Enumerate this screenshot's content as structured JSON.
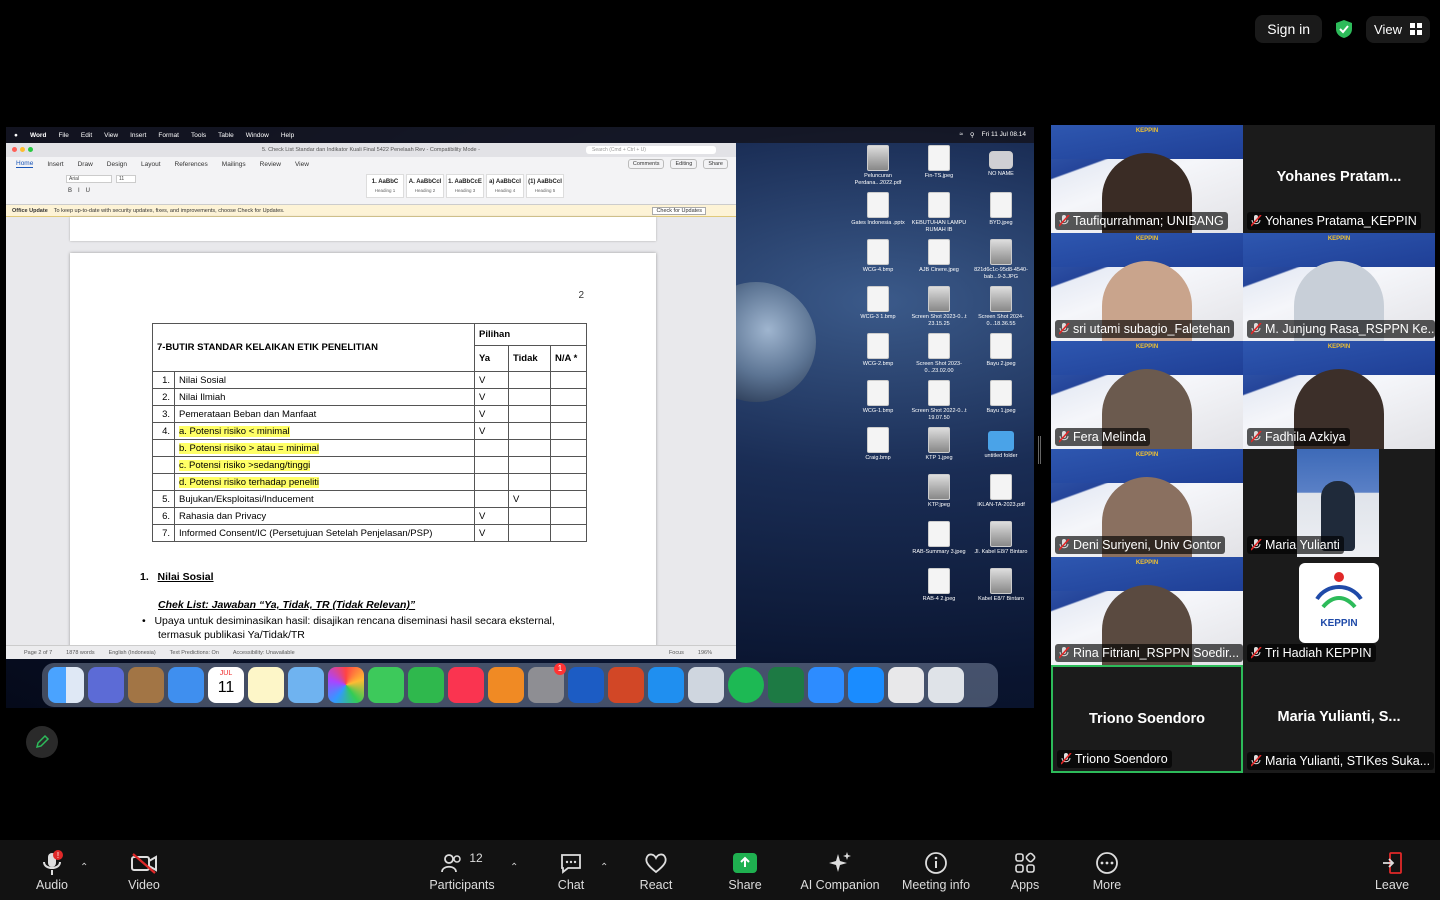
{
  "topbar": {
    "signin": "Sign in",
    "view": "View"
  },
  "macbar": {
    "app": "Word",
    "menus": [
      "File",
      "Edit",
      "View",
      "Insert",
      "Format",
      "Tools",
      "Table",
      "Window",
      "Help"
    ],
    "clock": "Fri 11 Jul  08.14"
  },
  "word": {
    "title": "5. Check List Standar dan Indikator Kuali Final 5422 Penelaah Rev  -  Compatibility Mode  -",
    "search": "Search (Cmd + Ctrl + U)",
    "tabs": [
      "Home",
      "Insert",
      "Draw",
      "Design",
      "Layout",
      "References",
      "Mailings",
      "Review",
      "View"
    ],
    "comments": "Comments",
    "editing": "Editing",
    "share": "Share",
    "font": "Arial",
    "size": "11",
    "styles": [
      {
        "s": "1.  AaBbC",
        "n": "Heading 1"
      },
      {
        "s": "A. AaBbCcI",
        "n": "Heading 2"
      },
      {
        "s": "1. AaBbCcE",
        "n": "Heading 3"
      },
      {
        "s": "a) AaBbCcI",
        "n": "Heading 4"
      },
      {
        "s": "(1) AaBbCcI",
        "n": "Heading 5"
      }
    ],
    "update_title": "Office Update",
    "update_text": "To keep up-to-date with security updates, fixes, and improvements, choose Check for Updates.",
    "update_btn": "Check for Updates",
    "page_no": "2",
    "table_title": "7-BUTIR STANDAR KELAIKAN ETIK PENELITIAN",
    "col_pilihan": "Pilihan",
    "col_ya": "Ya",
    "col_tidak": "Tidak",
    "col_na": "N/A *",
    "rows": [
      {
        "n": "1.",
        "t": "Nilai Sosial",
        "ya": "V",
        "tidak": ""
      },
      {
        "n": "2.",
        "t": "Nilai Ilmiah",
        "ya": "V",
        "tidak": ""
      },
      {
        "n": "3.",
        "t": "Pemerataan Beban dan Manfaat",
        "ya": "V",
        "tidak": ""
      },
      {
        "n": "4.",
        "t": "a.    Potensi risiko < minimal",
        "ya": "V",
        "tidak": ""
      },
      {
        "n": "",
        "t": "b.    Potensi risiko > atau = minimal",
        "ya": "",
        "tidak": ""
      },
      {
        "n": "",
        "t": "c.    Potensi risiko >sedang/tinggi",
        "ya": "",
        "tidak": ""
      },
      {
        "n": "",
        "t": "d.    Potensi risiko terhadap peneliti",
        "ya": "",
        "tidak": ""
      },
      {
        "n": "5.",
        "t": "Bujukan/Eksploitasi/Inducement",
        "ya": "",
        "tidak": "V"
      },
      {
        "n": "6.",
        "t": "Rahasia dan Privacy",
        "ya": "V",
        "tidak": ""
      },
      {
        "n": "7.",
        "t": "Informed Consent/IC (Persetujuan Setelah Penjelasan/PSP)",
        "ya": "V",
        "tidak": ""
      }
    ],
    "section_num": "1.",
    "section_title": "Nilai Sosial",
    "checklist": "Chek List: Jawaban “Ya, Tidak, TR (Tidak Relevan)”",
    "bullet1": "Upaya untuk desiminasikan hasil: disajikan rencana diseminasi hasil secara eksternal,",
    "bullet1b": "termasuk publikasi Ya/Tidak/TR",
    "status": [
      "Page 2 of 7",
      "1878 words",
      "English (Indonesia)",
      "Text Predictions: On",
      "Accessibility: Unavailable",
      "Focus",
      "196%"
    ]
  },
  "desktop_icons": [
    {
      "label": "Peluncuran Perdana...2022.pdf"
    },
    {
      "label": "Fin-TS.jpeg"
    },
    {
      "label": "NO NAME"
    },
    {
      "label": "Gates Indonesia .pptx"
    },
    {
      "label": "KEBUTUHAN LAMPU RUMAH IB"
    },
    {
      "label": "BYD.jpeg"
    },
    {
      "label": "WCG-4.bmp"
    },
    {
      "label": "AJB Cinere.jpeg"
    },
    {
      "label": "821d6c1c-95d8-4540-bab...9-3.JPG"
    },
    {
      "label": "WCG-3 1.bmp"
    },
    {
      "label": "Screen Shot 2023-0...t 23.15.25"
    },
    {
      "label": "Screen Shot 2024-0...18.36.55"
    },
    {
      "label": "WCG-2.bmp"
    },
    {
      "label": "Screen Shot 2023-0...23.02.00"
    },
    {
      "label": "Bayu 2.jpeg"
    },
    {
      "label": "WCG-1.bmp"
    },
    {
      "label": "Screen Shot 2022-0...t 19.07.50"
    },
    {
      "label": "Bayu 1.jpeg"
    },
    {
      "label": "Craig.bmp"
    },
    {
      "label": "KTP 1.jpeg"
    },
    {
      "label": "untitled folder"
    },
    {
      "label": "KTP.jpeg"
    },
    {
      "label": "IKLAN-TA-2023.pdf"
    },
    {
      "label": "RAB-Summary 3.jpeg"
    },
    {
      "label": "Jl. Kabel E8/7 Bintaro"
    },
    {
      "label": "RAB-4 2.jpeg"
    },
    {
      "label": "Kabel E8/7 Bintaro"
    }
  ],
  "dock": {
    "calendar_month": "JUL",
    "calendar_day": "11",
    "badge": "1"
  },
  "participants": [
    {
      "name": "Taufiqurrahman; UNIBANG",
      "big": ""
    },
    {
      "name": "Yohanes Pratama_KEPPIN",
      "big": "Yohanes  Pratam..."
    },
    {
      "name": "sri utami subagio_Faletehan",
      "big": ""
    },
    {
      "name": "M. Junjung Rasa_RSPPN Ke...",
      "big": ""
    },
    {
      "name": "Fera Melinda",
      "big": ""
    },
    {
      "name": "Fadhila Azkiya",
      "big": ""
    },
    {
      "name": "Deni Suriyeni, Univ Gontor",
      "big": ""
    },
    {
      "name": "Maria Yulianti",
      "big": ""
    },
    {
      "name": "Rina Fitriani_RSPPN Soedir...",
      "big": ""
    },
    {
      "name": "Tri Hadiah KEPPIN",
      "big": ""
    },
    {
      "name": "Triono Soendoro",
      "big": "Triono Soendoro"
    },
    {
      "name": "Maria Yulianti, STIKes Suka...",
      "big": "Maria  Yulianti,  S..."
    }
  ],
  "keppin_text": "KEPPIN",
  "toolbar": {
    "audio": "Audio",
    "video": "Video",
    "participants": "Participants",
    "participants_count": "12",
    "chat": "Chat",
    "react": "React",
    "share": "Share",
    "ai": "AI Companion",
    "info": "Meeting info",
    "apps": "Apps",
    "more": "More",
    "leave": "Leave",
    "audio_badge": "!"
  },
  "colors": {
    "accent_green": "#2dbb5a",
    "share_green": "#1fb050",
    "leave_red": "#e02828",
    "highlight": "#ffff66"
  }
}
